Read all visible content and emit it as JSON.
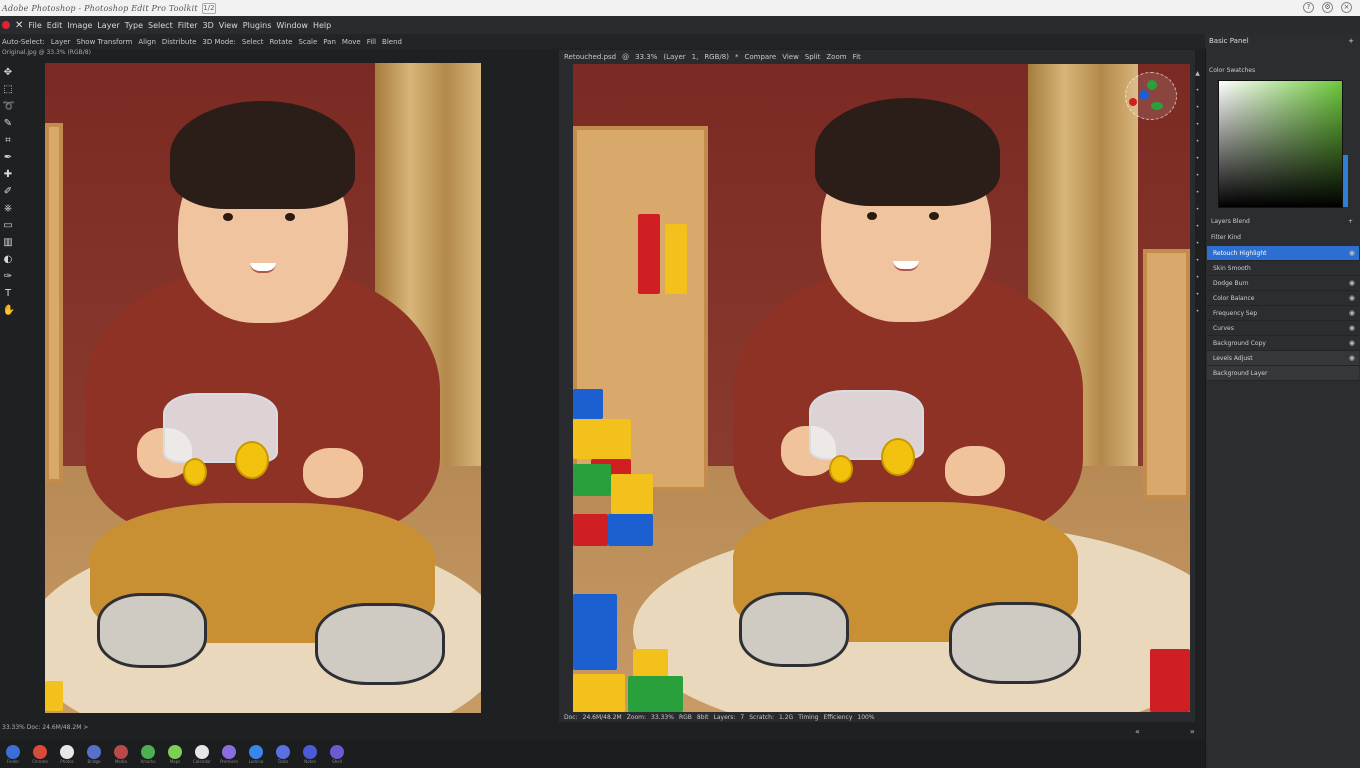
{
  "titlebar": {
    "title": "Adobe Photoshop - Photoshop Edit Pro Toolkit",
    "button_label": "1/2"
  },
  "menubar": {
    "items": [
      "File",
      "Edit",
      "Image",
      "Layer",
      "Type",
      "Select",
      "Filter",
      "3D",
      "View",
      "Plugins",
      "Window",
      "Help"
    ]
  },
  "options": {
    "items": [
      "Auto-Select:",
      "Layer",
      "Show Transform",
      "Align",
      "Distribute",
      "3D Mode:",
      "Select",
      "Rotate",
      "Scale",
      "Pan",
      "Move",
      "Fill",
      "Blend"
    ]
  },
  "left_doc": {
    "tab_label": "Original.jpg @ 33.3% (RGB/8)"
  },
  "right_doc": {
    "tab_items": [
      "Retouched.psd",
      "@",
      "33.3%",
      "(Layer",
      "1,",
      "RGB/8)",
      "*",
      "Compare",
      "View",
      "Split",
      "Zoom",
      "Fit"
    ],
    "status_items": [
      "Doc:",
      "24.6M/48.2M",
      "Zoom:",
      "33.33%",
      "RGB",
      "8bit",
      "Layers:",
      "7",
      "Scratch:",
      "1.2G",
      "Timing",
      "Efficiency",
      "100%"
    ]
  },
  "bottom": {
    "status_text": "33.33%   Doc: 24.6M/48.2M   >",
    "dock_apps": [
      {
        "label": "Finder",
        "color": "#3b6fd6"
      },
      {
        "label": "Chrome",
        "color": "#d84a3a"
      },
      {
        "label": "Photos",
        "color": "#e8e8e8"
      },
      {
        "label": "Bridge",
        "color": "#5870c8"
      },
      {
        "label": "Media",
        "color": "#b84a4a"
      },
      {
        "label": "Xmarks",
        "color": "#4caf50"
      },
      {
        "label": "Maps",
        "color": "#7ccf55"
      },
      {
        "label": "Calendar",
        "color": "#e6e6e6"
      },
      {
        "label": "Premiere",
        "color": "#8a6ee0"
      },
      {
        "label": "Lumina",
        "color": "#3a86e8"
      },
      {
        "label": "Tasks",
        "color": "#5b6fe0"
      },
      {
        "label": "Notes",
        "color": "#4a5ad8"
      },
      {
        "label": "Shell",
        "color": "#6a5cd0"
      }
    ],
    "prev_arrow": "«",
    "next_arrow": "»"
  },
  "right_panel": {
    "header": "Basic Panel",
    "header_plus": "+",
    "color_label": "Color Swatches",
    "layers_header": "Layers   Blend",
    "layers_plus": "+",
    "layers_sub": "Filter Kind",
    "layers": [
      {
        "label": "Retouch Highlight",
        "state": "selected"
      },
      {
        "label": "Skin Smooth",
        "state": "normal"
      },
      {
        "label": "Dodge Burn",
        "state": "normal"
      },
      {
        "label": "Color Balance",
        "state": "normal"
      },
      {
        "label": "Frequency Sep",
        "state": "normal"
      },
      {
        "label": "Curves",
        "state": "normal"
      },
      {
        "label": "Background Copy",
        "state": "normal"
      },
      {
        "label": "Levels Adjust",
        "state": "dim"
      },
      {
        "label": "Background Layer",
        "state": "dim"
      }
    ]
  },
  "colors": {
    "accent_blue": "#2d6fd0",
    "panel_bg": "#2c2d30",
    "wall_red": "#7b2a23",
    "hoodie": "#8e3226"
  }
}
